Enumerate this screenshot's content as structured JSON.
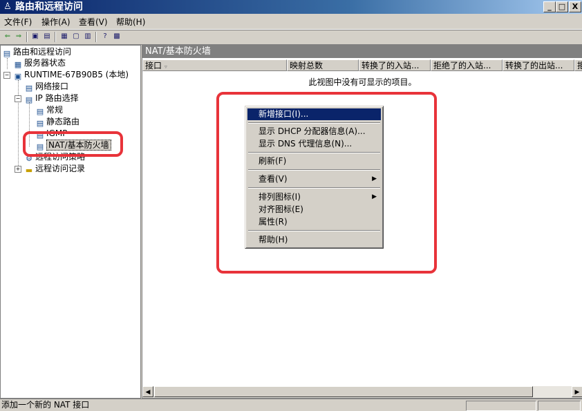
{
  "window": {
    "title": "路由和远程访问",
    "buttons": {
      "minimize": "_",
      "maximize": "□",
      "close": "X"
    }
  },
  "menubar": {
    "items": [
      "文件(F)",
      "操作(A)",
      "查看(V)",
      "帮助(H)"
    ]
  },
  "toolbar": {
    "icons": [
      "back-icon",
      "forward-icon",
      "up-icon",
      "show-tree-icon",
      "properties-icon",
      "refresh-icon",
      "export-icon",
      "help-icon",
      "console-icon"
    ]
  },
  "tree": {
    "root": "路由和远程访问",
    "server_status": "服务器状态",
    "server": "RUNTIME-67B90B5 (本地)",
    "network_interfaces": "网络接口",
    "ip_routing": "IP 路由选择",
    "general": "常规",
    "static_routes": "静态路由",
    "igmp": "IGMP",
    "nat": "NAT/基本防火墙",
    "remote_access_policies": "远程访问策略",
    "remote_access_logging": "远程访问记录"
  },
  "pane": {
    "title": "NAT/基本防火墙",
    "columns": [
      "接口",
      "映射总数",
      "转换了的入站...",
      "拒绝了的入站...",
      "转换了的出站...",
      "拒"
    ],
    "empty_message": "此视图中没有可显示的项目。"
  },
  "context_menu": {
    "items": [
      "新增接口(I)...",
      "显示 DHCP 分配器信息(A)...",
      "显示 DNS 代理信息(N)...",
      "刷新(F)",
      "查看(V)",
      "排列图标(I)",
      "对齐图标(E)",
      "属性(R)",
      "帮助(H)"
    ]
  },
  "status": {
    "text": "添加一个新的 NAT 接口"
  },
  "colors": {
    "highlight_border": "#e8333a",
    "title_blue": "#0a246a",
    "menu_highlight": "#0a246a"
  }
}
